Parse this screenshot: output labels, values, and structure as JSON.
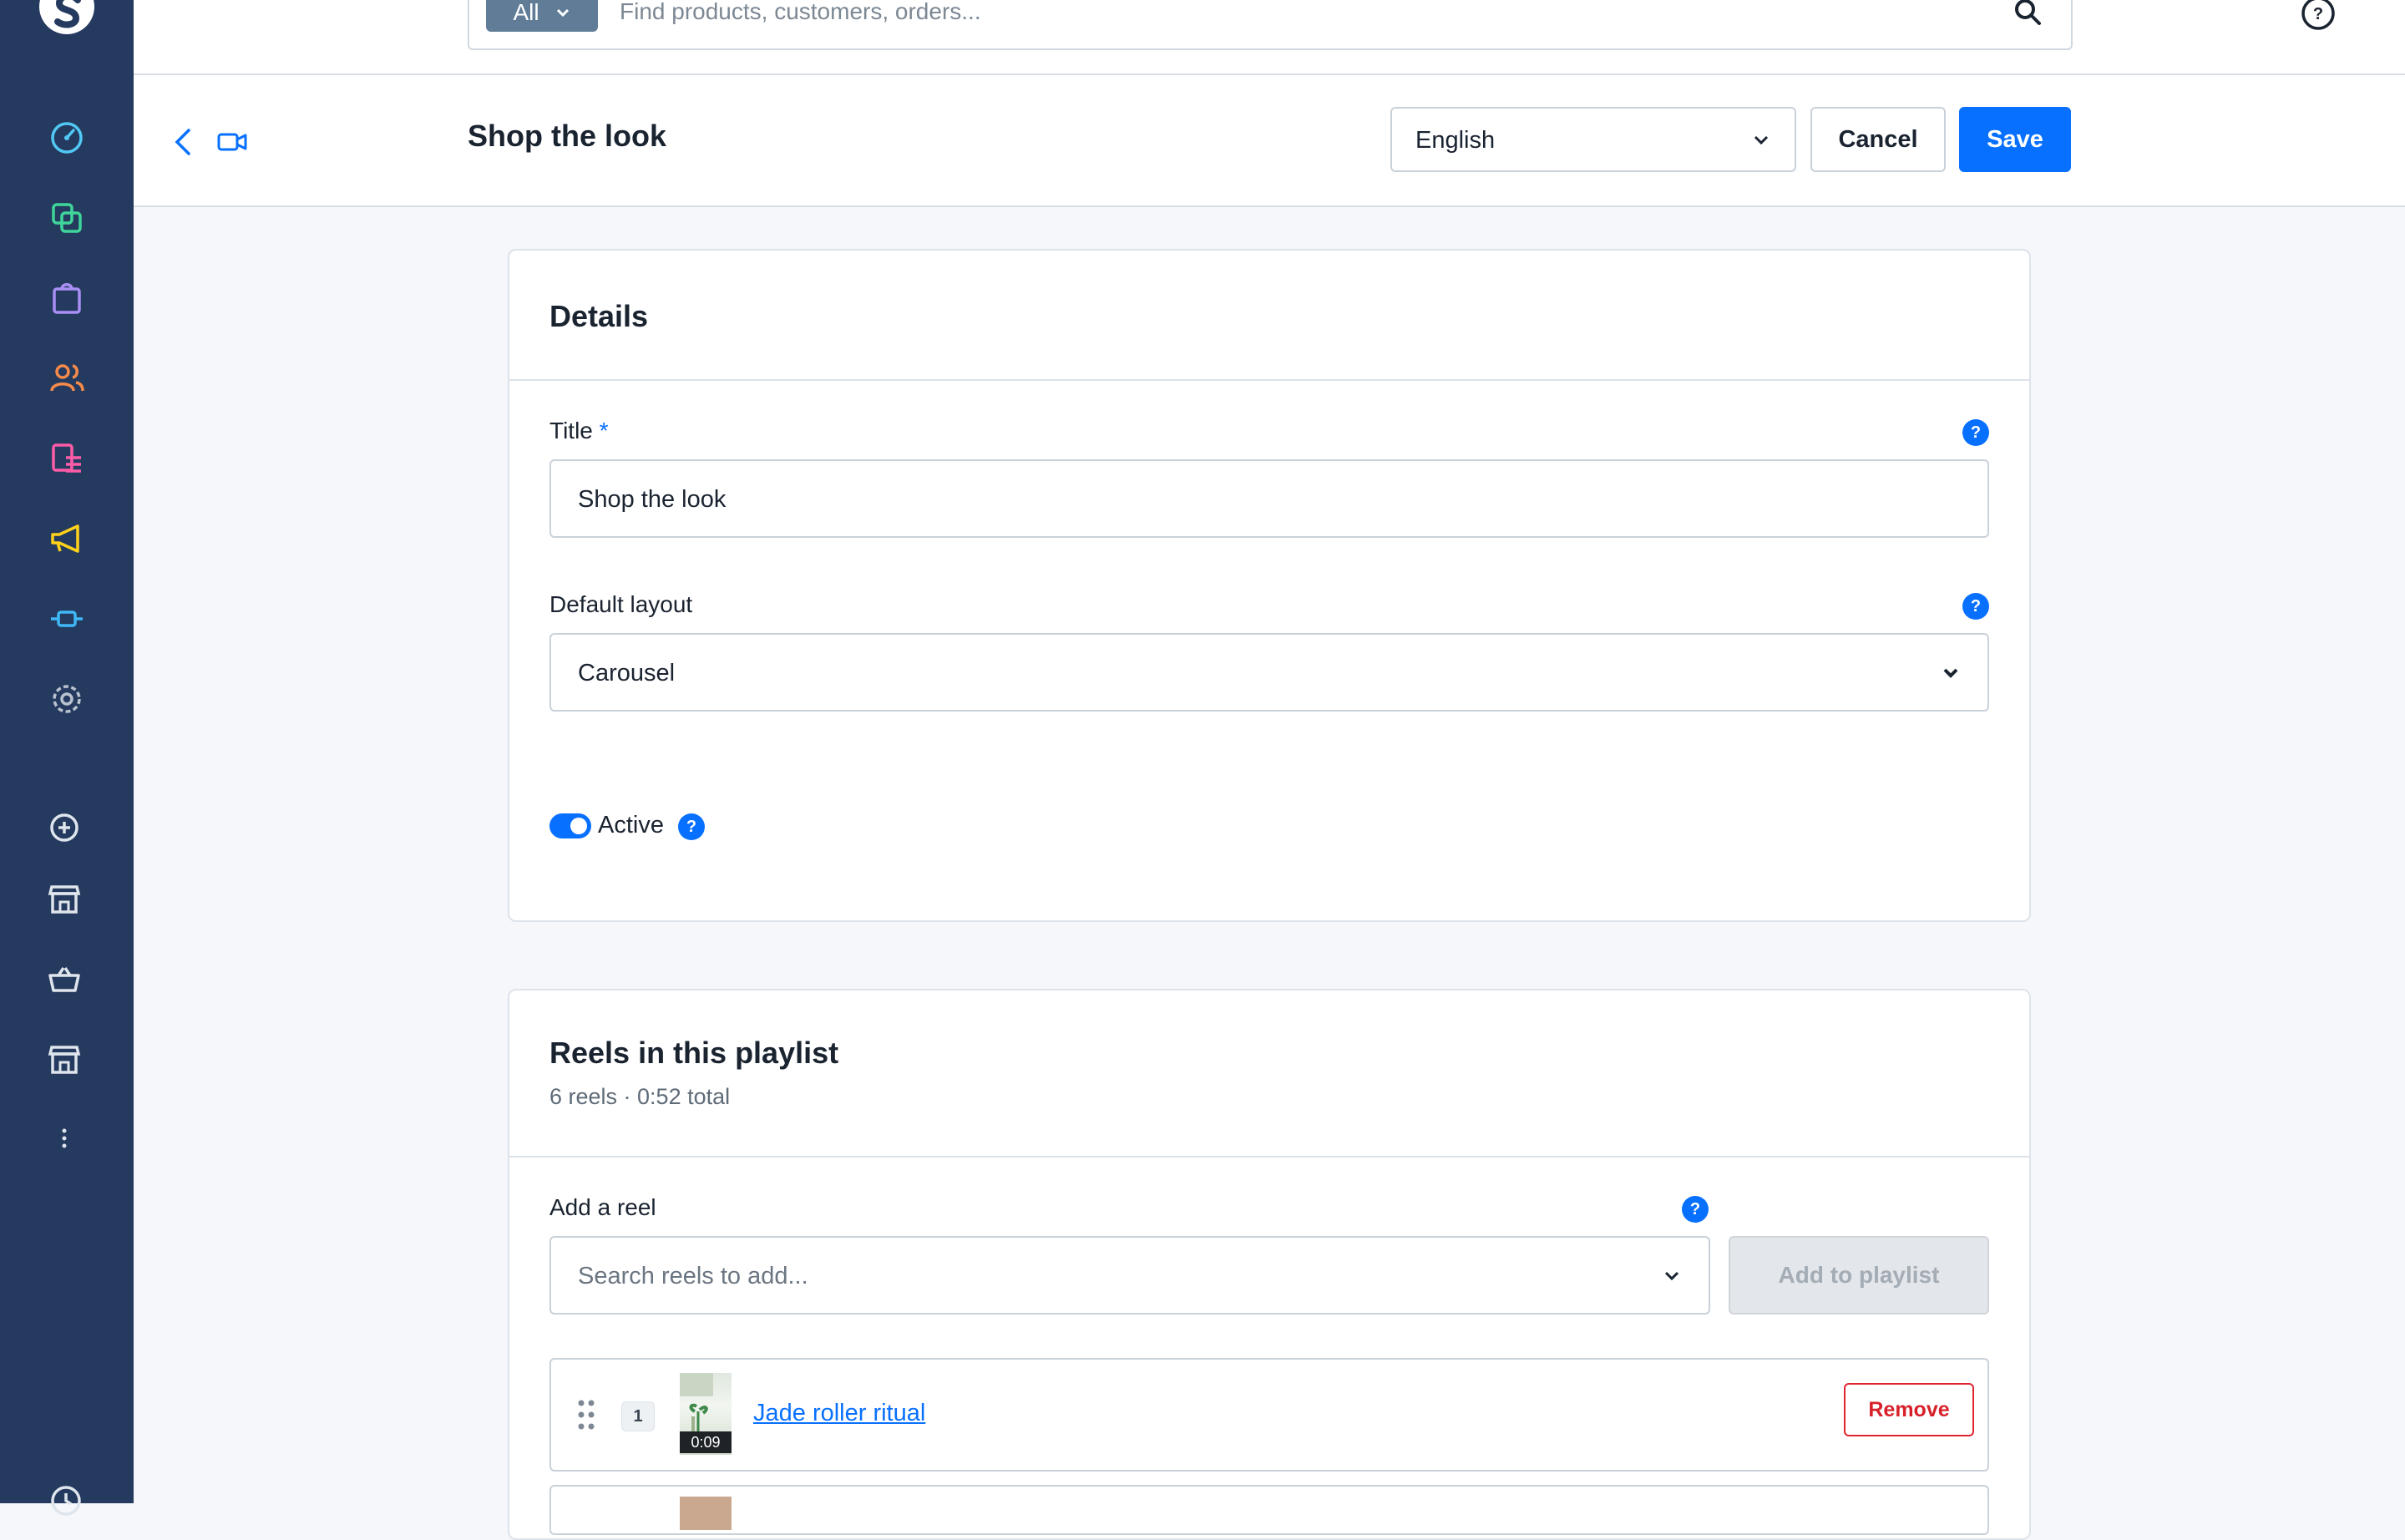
{
  "search": {
    "scope_label": "All",
    "placeholder": "Find products, customers, orders..."
  },
  "header": {
    "title": "Shop the look",
    "language": "English",
    "cancel_label": "Cancel",
    "save_label": "Save"
  },
  "details": {
    "heading": "Details",
    "title_label": "Title",
    "title_required": "*",
    "title_value": "Shop the look",
    "layout_label": "Default layout",
    "layout_value": "Carousel",
    "active_label": "Active",
    "active_on": true
  },
  "playlist": {
    "heading": "Reels in this playlist",
    "summary": "6 reels · 0:52 total",
    "add_label": "Add a reel",
    "search_placeholder": "Search reels to add...",
    "add_button": "Add to playlist",
    "reels": [
      {
        "index": "1",
        "title": "Jade roller ritual",
        "duration": "0:09",
        "remove_label": "Remove"
      }
    ]
  },
  "help_glyph": "?",
  "colors": {
    "sidebar": "#243a5e",
    "primary": "#0870ff",
    "danger": "#d8202b"
  },
  "icons": {
    "sidebar": [
      "dashboard-icon",
      "catalog-icon",
      "orders-icon",
      "customers-icon",
      "content-icon",
      "marketing-icon",
      "extensions-icon",
      "settings-icon",
      "add-icon",
      "storefront-icon",
      "basket-icon",
      "storefront-icon",
      "more-icon",
      "clock-icon"
    ]
  }
}
